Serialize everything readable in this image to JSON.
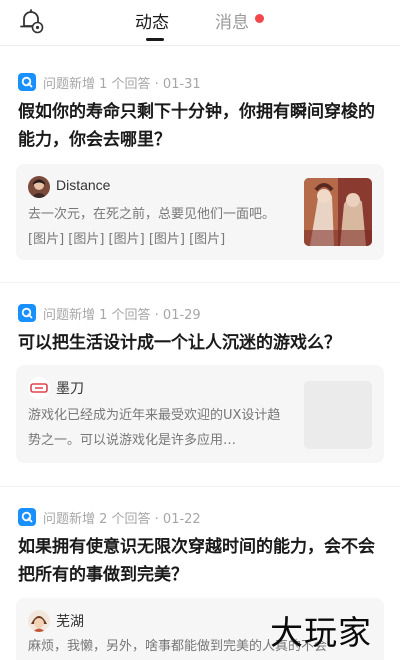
{
  "header": {
    "tabs": [
      {
        "label": "动态",
        "active": true
      },
      {
        "label": "消息",
        "active": false,
        "has_unread_dot": true
      }
    ],
    "bell_icon": "notification-settings-icon",
    "dot_color": "#f2464b"
  },
  "feed": [
    {
      "meta": "问题新增 1 个回答 · 01-31",
      "title": "假如你的寿命只剩下十分钟，你拥有瞬间穿梭的能力，你会去哪里？",
      "answer": {
        "author": "Distance",
        "excerpt": "去一次元，在死之前，总要见他们一面吧。[图片] [图片] [图片] [图片] [图片]",
        "has_thumbnail": true
      }
    },
    {
      "meta": "问题新增 1 个回答 · 01-29",
      "title": "可以把生活设计成一个让人沉迷的游戏么？",
      "answer": {
        "author": "墨刀",
        "excerpt": "游戏化已经成为近年来最受欢迎的UX设计趋势之一。可以说游戏化是许多应用…",
        "has_thumbnail": true
      }
    },
    {
      "meta": "问题新增 2 个回答 · 01-22",
      "title": "如果拥有使意识无限次穿越时间的能力，会不会把所有的事做到完美？",
      "answer": {
        "author": "芜湖",
        "excerpt": "麻烦，我懒，另外，啥事都能做到完美的人真的不会"
      }
    }
  ],
  "watermark": "大玩家",
  "accent_color": "#1890ff"
}
